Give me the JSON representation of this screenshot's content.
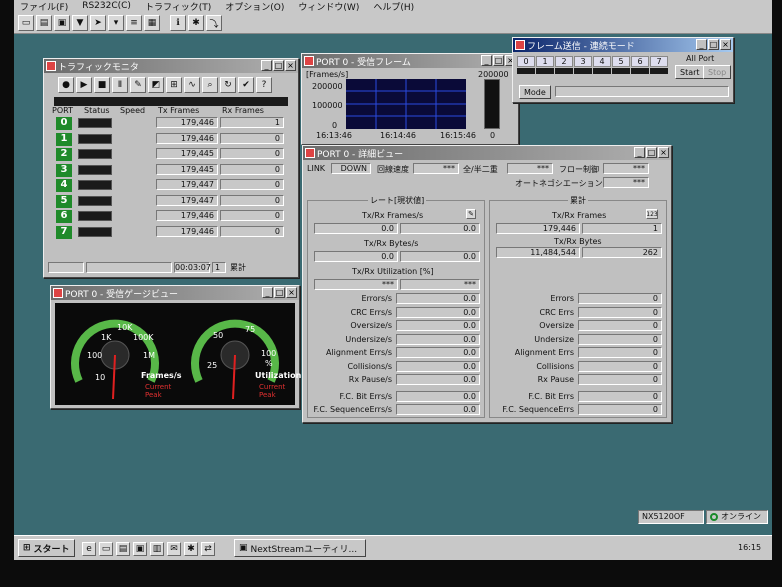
{
  "menu": [
    "ファイル(F)",
    "RS232C(C)",
    "トラフィック(T)",
    "オプション(O)",
    "ウィンドウ(W)",
    "ヘルプ(H)"
  ],
  "traffic": {
    "title": "トラフィックモニタ",
    "headers": [
      "PORT",
      "Status",
      "Speed",
      "Tx Frames",
      "Rx Frames"
    ],
    "rows": [
      {
        "p": "0",
        "tx": "179,446",
        "rx": "1"
      },
      {
        "p": "1",
        "tx": "179,446",
        "rx": "0"
      },
      {
        "p": "2",
        "tx": "179,445",
        "rx": "0"
      },
      {
        "p": "3",
        "tx": "179,445",
        "rx": "0"
      },
      {
        "p": "4",
        "tx": "179,447",
        "rx": "0"
      },
      {
        "p": "5",
        "tx": "179,447",
        "rx": "0"
      },
      {
        "p": "6",
        "tx": "179,446",
        "rx": "0"
      },
      {
        "p": "7",
        "tx": "179,446",
        "rx": "0"
      }
    ],
    "time": "00:03:07",
    "count": "1",
    "mode": "累計"
  },
  "frames": {
    "title": "PORT 0 - 受信フレーム",
    "unit": "[Frames/s]",
    "y": [
      "200000",
      "100000",
      "0"
    ],
    "x": [
      "16:13:46",
      "16:14:46",
      "16:15:46"
    ],
    "right_top": "200000",
    "right_bottom": "0"
  },
  "send": {
    "title": "フレーム送信 - 連続モード",
    "ports": [
      "0",
      "1",
      "2",
      "3",
      "4",
      "5",
      "6",
      "7"
    ],
    "all": "All Port",
    "start": "Start",
    "stop": "Stop",
    "mode": "Mode"
  },
  "detail": {
    "title": "PORT 0 - 詳細ビュー",
    "link_lbl": "LINK",
    "link": "DOWN",
    "speed_lbl": "回線速度",
    "speed": "***",
    "duplex_lbl": "全/半二重",
    "duplex": "***",
    "flow_lbl": "フロー制御",
    "flow": "***",
    "auto_lbl": "オートネゴシエーション",
    "auto": "***",
    "rate_title": "レート[現状値]",
    "total_title": "累計",
    "rate_frames_lbl": "Tx/Rx Frames/s",
    "rate_frames": [
      "0.0",
      "0.0"
    ],
    "rate_bytes_lbl": "Tx/Rx Bytes/s",
    "rate_bytes": [
      "0.0",
      "0.0"
    ],
    "rate_util_lbl": "Tx/Rx Utilization [%]",
    "rate_util": [
      "***",
      "***"
    ],
    "tot_frames_lbl": "Tx/Rx Frames",
    "tot_frames": [
      "179,446",
      "1"
    ],
    "tot_bytes_lbl": "Tx/Rx Bytes",
    "tot_bytes": [
      "11,484,544",
      "262"
    ],
    "rate_errs": [
      {
        "l": "Errors/s",
        "v": "0.0"
      },
      {
        "l": "CRC Errs/s",
        "v": "0.0"
      },
      {
        "l": "Oversize/s",
        "v": "0.0"
      },
      {
        "l": "Undersize/s",
        "v": "0.0"
      },
      {
        "l": "Alignment Errs/s",
        "v": "0.0"
      },
      {
        "l": "Collisions/s",
        "v": "0.0"
      },
      {
        "l": "Rx Pause/s",
        "v": "0.0"
      }
    ],
    "tot_errs": [
      {
        "l": "Errors",
        "v": "0"
      },
      {
        "l": "CRC Errs",
        "v": "0"
      },
      {
        "l": "Oversize",
        "v": "0"
      },
      {
        "l": "Undersize",
        "v": "0"
      },
      {
        "l": "Alignment Errs",
        "v": "0"
      },
      {
        "l": "Collisions",
        "v": "0"
      },
      {
        "l": "Rx Pause",
        "v": "0"
      }
    ],
    "fc_rate": [
      {
        "l": "F.C. Bit Errs/s",
        "v": "0.0"
      },
      {
        "l": "F.C. SequenceErrs/s",
        "v": "0.0"
      }
    ],
    "fc_tot": [
      {
        "l": "F.C. Bit Errs",
        "v": "0"
      },
      {
        "l": "F.C. SequenceErrs",
        "v": "0"
      }
    ]
  },
  "gauge": {
    "title": "PORT 0 - 受信ゲージビュー",
    "g1": [
      "10K",
      "1K",
      "100K",
      "100",
      "1M",
      "10"
    ],
    "g1_lbl": "Frames/s",
    "g2": [
      "50",
      "75",
      "25",
      "100"
    ],
    "g2_unit": "%",
    "g2_lbl": "Utilization",
    "current": "Current",
    "peak": "Peak"
  },
  "taskbar": {
    "start": "スタート",
    "app": "NextStreamユーティリ...",
    "clock": "16:15",
    "device": "NX5120OF",
    "online": "オンライン"
  }
}
